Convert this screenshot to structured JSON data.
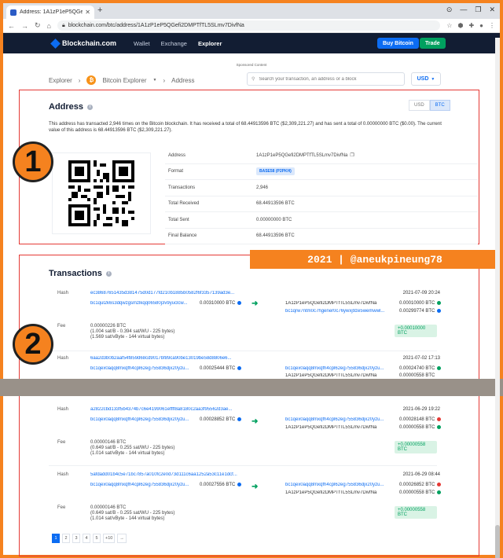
{
  "browser": {
    "tab_title": "Address: 1A1zP1eP5QGefi2DMP",
    "url": "blockchain.com/btc/address/1A1zP1eP5QGefi2DMPTfTL5SLmv7DivfNa"
  },
  "header": {
    "logo": "Blockchain.com",
    "nav": [
      "Wallet",
      "Exchange",
      "Explorer"
    ],
    "buy_label": "Buy Bitcoin",
    "trade_label": "Trade",
    "sponsored": "Sponsored Content"
  },
  "breadcrumb": {
    "explorer": "Explorer",
    "bitcoin": "Bitcoin Explorer",
    "current": "Address"
  },
  "search": {
    "placeholder": "Search your transaction, an address or a block"
  },
  "currency_select": "USD",
  "address_panel": {
    "title": "Address",
    "toggle": [
      "USD",
      "BTC"
    ],
    "summary": "This address has transacted 2,946 times on the Bitcoin blockchain. It has received a total of 68.44913596 BTC ($2,309,221.27) and has sent a total of 0.00000000 BTC ($0.00). The current value of this address is 68.44913596 BTC ($2,309,221.27).",
    "rows": [
      {
        "label": "Address",
        "value": "1A1zP1eP5QGefi2DMPTfTL5SLmv7DivfNa"
      },
      {
        "label": "Format",
        "value": "BASE58 (P2PKH)"
      },
      {
        "label": "Transactions",
        "value": "2,946"
      },
      {
        "label": "Total Received",
        "value": "68.44913596 BTC"
      },
      {
        "label": "Total Sent",
        "value": "0.00000000 BTC"
      },
      {
        "label": "Final Balance",
        "value": "68.44913596 BTC"
      }
    ]
  },
  "markers": [
    "1",
    "2"
  ],
  "watermark": "2021 | @aneukpineung78",
  "transactions": {
    "title": "Transactions",
    "hash_label": "Hash",
    "fee_label": "Fee",
    "items": [
      {
        "hash": "ec38687651435d381475d0d177fd210b1885b0582f6f3357139ad3e...",
        "date": "2021-07-09 20:24",
        "from": "bc1qul2k6s3dqwzgsmzlkqq06580j3v9yuclcw...",
        "from_amount": "0.00310000 BTC",
        "to": [
          {
            "addr": "1A1zP1eP5QGefi2DMPTfTL5SLmv7DivfNa",
            "amount": "0.00010000 BTC"
          },
          {
            "addr": "bc1qrw7ntm0c7hgener0c76ywxj9ze5wemwwl...",
            "amount": "0.00299774 BTC"
          }
        ],
        "fee": [
          "0.00000226 BTC",
          "(1.004 sat/B - 0.394 sat/WU - 225 bytes)",
          "(1.569 sat/vByte - 144 virtual bytes)"
        ],
        "net": "+0.00010000 BTC"
      },
      {
        "hash": "6aa2d3b0b2aaf54f859d68cd9017bf89ca90be13019be58d8806e6...",
        "date": "2021-07-02 17:13",
        "from": "bc1qex0aqq8mxqfh4cpl62eg755836djx20yzu...",
        "from_amount": "0.00025444 BTC",
        "to": [
          {
            "addr": "bc1qex0aqq8mxqfh4cpl62eg755836djx20yzu...",
            "amount": "0.00024740 BTC"
          },
          {
            "addr": "1A1zP1eP5QGefi2DMPTfTL5SLmv7DivfNa",
            "amount": "0.00000558 BTC"
          }
        ]
      },
      {
        "hash": "a2822cbd133f5b4374b7c6e4199061effff8a8180c2aa3f95562d3ae...",
        "date": "2021-06-29 19:22",
        "from": "bc1qex0aqq8mxqfh4cpl62eg755836djx20yzu...",
        "from_amount": "0.00028852 BTC",
        "to": [
          {
            "addr": "bc1qex0aqq8mxqfh4cpl62eg755836djx20yzu...",
            "amount": "0.00028148 BTC"
          },
          {
            "addr": "1A1zP1eP5QGefi2DMPTfTL5SLmv7DivfNa",
            "amount": "0.00000558 BTC"
          }
        ],
        "fee": [
          "0.00000146 BTC",
          "(0.649 sat/B - 0.255 sat/WU - 225 bytes)",
          "(1.014 sat/vByte - 144 virtual bytes)"
        ],
        "net": "+0.00000558 BTC"
      },
      {
        "hash": "5afdadd01b4c5e71bc7857a010fc2e0d73d111c6aa1252a53c11e1dcf...",
        "date": "2021-06-29 08:44",
        "from": "bc1qex0aqq8mxqfh4cpl62eg755836djx20yzu...",
        "from_amount": "0.00027556 BTC",
        "to": [
          {
            "addr": "bc1qex0aqq8mxqfh4cpl62eg755836djx20yzu...",
            "amount": "0.00026852 BTC"
          },
          {
            "addr": "1A1zP1eP5QGefi2DMPTfTL5SLmv7DivfNa",
            "amount": "0.00000558 BTC"
          }
        ],
        "fee": [
          "0.00000146 BTC",
          "(0.649 sat/B - 0.255 sat/WU - 225 bytes)",
          "(1.014 sat/vByte - 144 virtual bytes)"
        ],
        "net": "+0.00000558 BTC"
      }
    ]
  },
  "pagination": [
    "1",
    "2",
    "3",
    "4",
    "5",
    "+10",
    "→"
  ]
}
